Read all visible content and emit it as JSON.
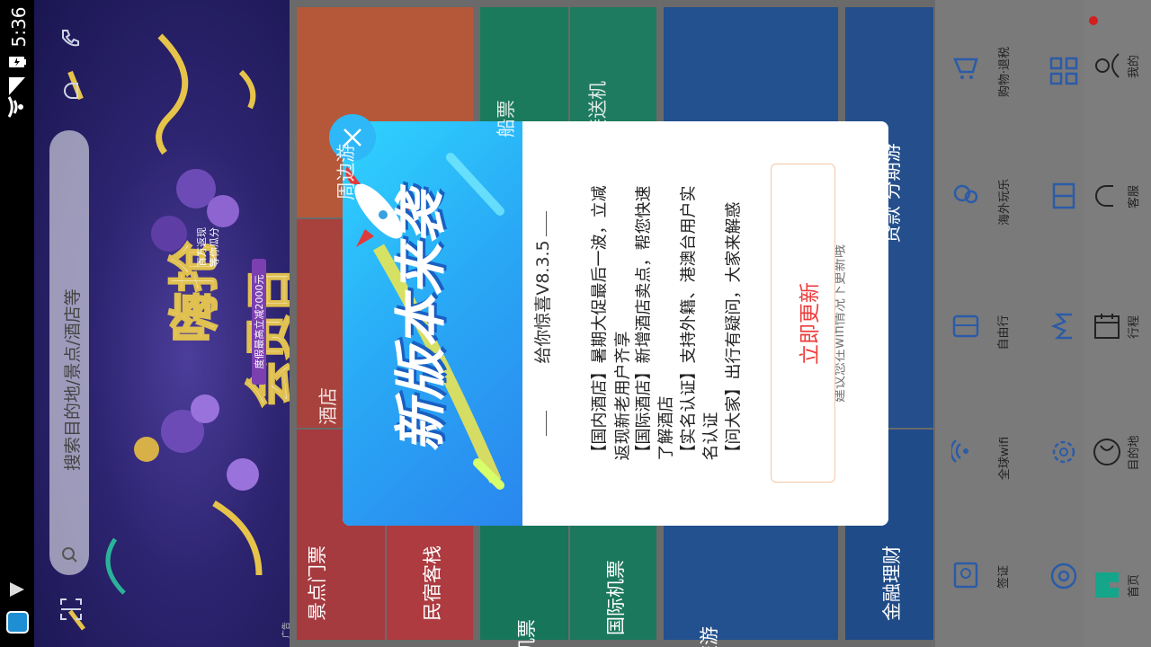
{
  "status_bar": {
    "time": "5:36"
  },
  "banner": {
    "search_placeholder": "搜索目的地/景点/酒店等",
    "promo_title_line1": "嗨抢",
    "promo_title_line2": "会员日",
    "promo_sub1": "百万返现",
    "promo_sub2": "等你瓜分",
    "promo_sub3": "度假最高立减2000元",
    "ad_tag": "广告"
  },
  "grid": {
    "tiles": [
      {
        "label": "景点门票"
      },
      {
        "label": "民宿客栈"
      },
      {
        "label": "周边游"
      },
      {
        "label": "酒店"
      },
      {
        "label": "机票"
      },
      {
        "label": "国际机票"
      },
      {
        "label": "船票"
      },
      {
        "label": "接送机"
      },
      {
        "label": "旅游"
      },
      {
        "label": "金融理财"
      },
      {
        "label": "贷款 分期游"
      }
    ]
  },
  "nav": {
    "items": [
      {
        "label": "签证",
        "icon": "passport-icon"
      },
      {
        "label": "全球wifi",
        "icon": "wifi-icon"
      },
      {
        "label": "自由行",
        "icon": "bag-icon"
      },
      {
        "label": "海外玩乐",
        "icon": "balloon-icon"
      },
      {
        "label": "购物·退税",
        "icon": "cart-icon"
      },
      {
        "label": "首页",
        "icon": "home-icon"
      },
      {
        "label": "目的地",
        "icon": "globe-icon"
      },
      {
        "label": "行程",
        "icon": "calendar-icon"
      },
      {
        "label": "客服",
        "icon": "headset-icon"
      },
      {
        "label": "我的",
        "icon": "user-icon"
      }
    ]
  },
  "dialog": {
    "art_title": "新版本来袭",
    "heading": "给你惊喜V8.3.5",
    "lines": [
      "【国内酒店】暑期大促最后一波，立减",
      "返现新老用户齐享",
      "【国际酒店】新增酒店卖点，帮您快速",
      "了解酒店",
      "【实名认证】支持外籍、港澳台用户实",
      "名认证",
      "【问大家】出行有疑问，大家来解惑"
    ],
    "update_button": "立即更新",
    "wifi_hint": "建议您在wifi情况下更新哦"
  },
  "colors": {
    "accent": "#2fb8f7",
    "update_text": "#ee3b3b",
    "nav_icon": "#3b6fb6",
    "home_active": "#1aa58f"
  }
}
